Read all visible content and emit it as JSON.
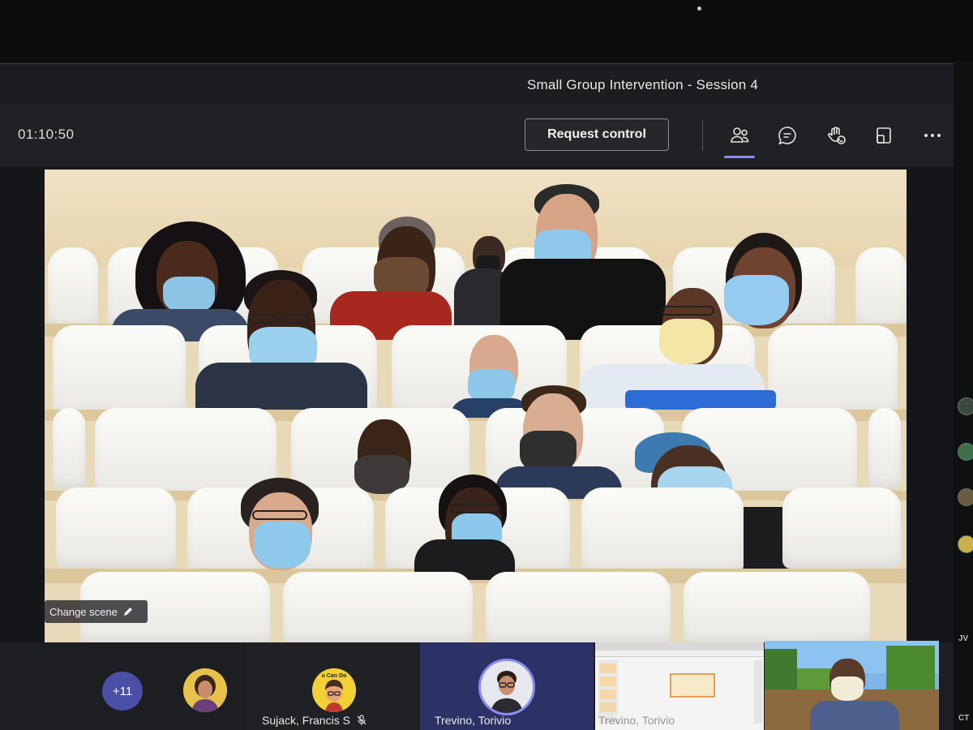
{
  "window": {
    "title": "Small Group Intervention - Session 4"
  },
  "toolbar": {
    "timer": "01:10:50",
    "request_control_label": "Request control",
    "icons": [
      "people-icon",
      "chat-icon",
      "raise-hand-icon",
      "share-tray-icon",
      "more-options-icon"
    ],
    "accent": "#8b8cf0"
  },
  "video": {
    "change_scene_label": "Change scene"
  },
  "participants": {
    "overflow_count": "+11",
    "tiles": [
      {
        "name": "Sujack, Francis S",
        "avatar_text": "u Can Do",
        "muted": true
      },
      {
        "name": "Trevino, Torivio",
        "muted": false
      },
      {
        "name": "Trevino, Torivio",
        "muted": false
      }
    ]
  },
  "side": {
    "initials": [
      "JV",
      "CT"
    ]
  },
  "colors": {
    "toolbar_bg": "#202124",
    "overflow_badge": "#4b4fa6",
    "active_tile_bg": "#2d3266"
  }
}
